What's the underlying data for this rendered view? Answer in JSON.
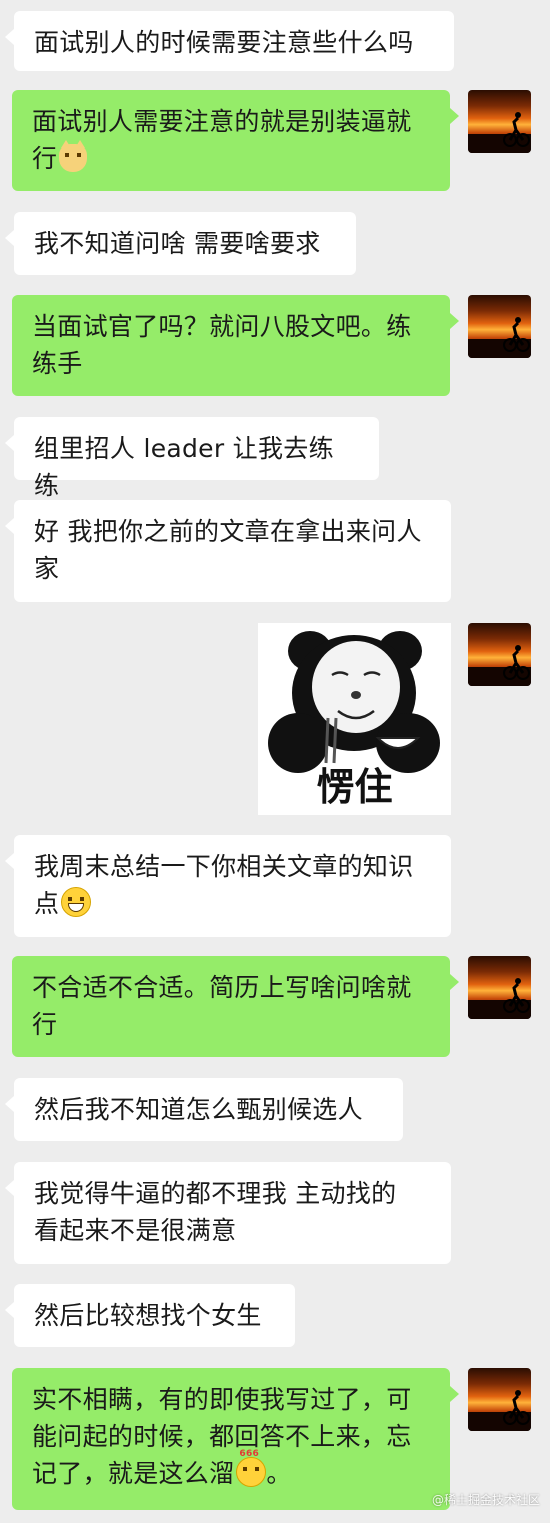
{
  "messages": [
    {
      "side": "left",
      "text": "面试别人的时候需要注意些什么吗"
    },
    {
      "side": "right",
      "line1": "面试别人需要注意的就是别装逼就",
      "line2": "行",
      "emoji": "cat-face-icon"
    },
    {
      "side": "left",
      "text": "我不知道问啥 需要啥要求"
    },
    {
      "side": "right",
      "line1": "当面试官了吗？就问八股文吧。练",
      "line2": "练手"
    },
    {
      "side": "left",
      "text": "组里招人 leader 让我去练练"
    },
    {
      "side": "left",
      "line1": "好 我把你之前的文章在拿出来问人",
      "line2": "家"
    },
    {
      "side": "right",
      "type": "sticker",
      "caption": "愣住"
    },
    {
      "side": "left",
      "line1": "我周末总结一下你相关文章的知识",
      "line2": "点",
      "emoji": "grinning-face-icon"
    },
    {
      "side": "right",
      "line1": "不合适不合适。简历上写啥问啥就",
      "line2": "行"
    },
    {
      "side": "left",
      "text": "然后我不知道怎么甄别候选人"
    },
    {
      "side": "left",
      "line1": "我觉得牛逼的都不理我 主动找的",
      "line2": "看起来不是很满意"
    },
    {
      "side": "left",
      "text": "然后比较想找个女生"
    },
    {
      "side": "right",
      "line1": "实不相瞒，有的即使我写过了，可",
      "line2": "能问起的时候，都回答不上来，忘",
      "line3": "记了，就是这么溜",
      "line3_end": "。",
      "emoji": "666-emoji-icon",
      "emoji_tag": "666"
    }
  ],
  "watermark": "@稀土掘金技术社区",
  "colors": {
    "background": "#ededed",
    "incoming": "#ffffff",
    "outgoing": "#95ec69"
  }
}
